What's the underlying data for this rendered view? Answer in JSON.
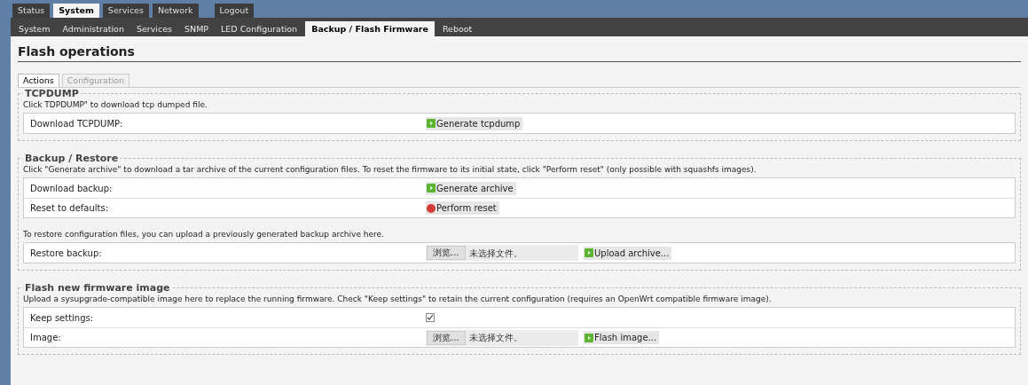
{
  "main_tabs": [
    {
      "label": "Status",
      "selected": false
    },
    {
      "label": "System",
      "selected": true
    },
    {
      "label": "Services",
      "selected": false
    },
    {
      "label": "Network",
      "selected": false
    },
    {
      "label": "Logout",
      "selected": false
    }
  ],
  "sub_tabs": [
    {
      "label": "System",
      "selected": false
    },
    {
      "label": "Administration",
      "selected": false
    },
    {
      "label": "Services",
      "selected": false
    },
    {
      "label": "SNMP",
      "selected": false
    },
    {
      "label": "LED Configuration",
      "selected": false
    },
    {
      "label": "Backup / Flash Firmware",
      "selected": true
    },
    {
      "label": "Reboot",
      "selected": false
    }
  ],
  "page_title": "Flash operations",
  "section_tabs": [
    {
      "label": "Actions",
      "selected": true,
      "disabled": false
    },
    {
      "label": "Configuration",
      "selected": false,
      "disabled": true
    }
  ],
  "sections": [
    {
      "title": "TCPDUMP",
      "description": "Click TDPDUMP\" to download tcp dumped file.",
      "items": [
        {
          "kind": "table",
          "rows": [
            {
              "label": "Download TCPDUMP:",
              "kind": "button",
              "button": {
                "label": "Generate tcpdump",
                "kind": "apply"
              }
            }
          ]
        }
      ]
    },
    {
      "title": "Backup / Restore",
      "description": "Click \"Generate archive\" to download a tar archive of the current configuration files. To reset the firmware to its initial state, click \"Perform reset\" (only possible with squashfs images).",
      "items": [
        {
          "kind": "table",
          "rows": [
            {
              "label": "Download backup:",
              "kind": "button",
              "button": {
                "label": "Generate archive",
                "kind": "apply"
              }
            },
            {
              "label": "Reset to defaults:",
              "kind": "button",
              "button": {
                "label": "Perform reset",
                "kind": "reset"
              }
            }
          ]
        },
        {
          "kind": "note",
          "text": "To restore configuration files, you can upload a previously generated backup archive here."
        },
        {
          "kind": "table",
          "rows": [
            {
              "label": "Restore backup:",
              "kind": "file",
              "browse": "浏览...",
              "file_status": "未选择文件。",
              "button": {
                "label": "Upload archive...",
                "kind": "apply"
              }
            }
          ]
        }
      ]
    },
    {
      "title": "Flash new firmware image",
      "description": "Upload a sysupgrade-compatible image here to replace the running firmware. Check \"Keep settings\" to retain the current configuration (requires an OpenWrt compatible firmware image).",
      "items": [
        {
          "kind": "table",
          "rows": [
            {
              "label": "Keep settings:",
              "kind": "checkbox",
              "checked": true
            },
            {
              "label": "Image:",
              "kind": "file",
              "browse": "浏览...",
              "file_status": "未选择文件。",
              "button": {
                "label": "Flash image...",
                "kind": "apply"
              }
            }
          ]
        }
      ]
    }
  ]
}
